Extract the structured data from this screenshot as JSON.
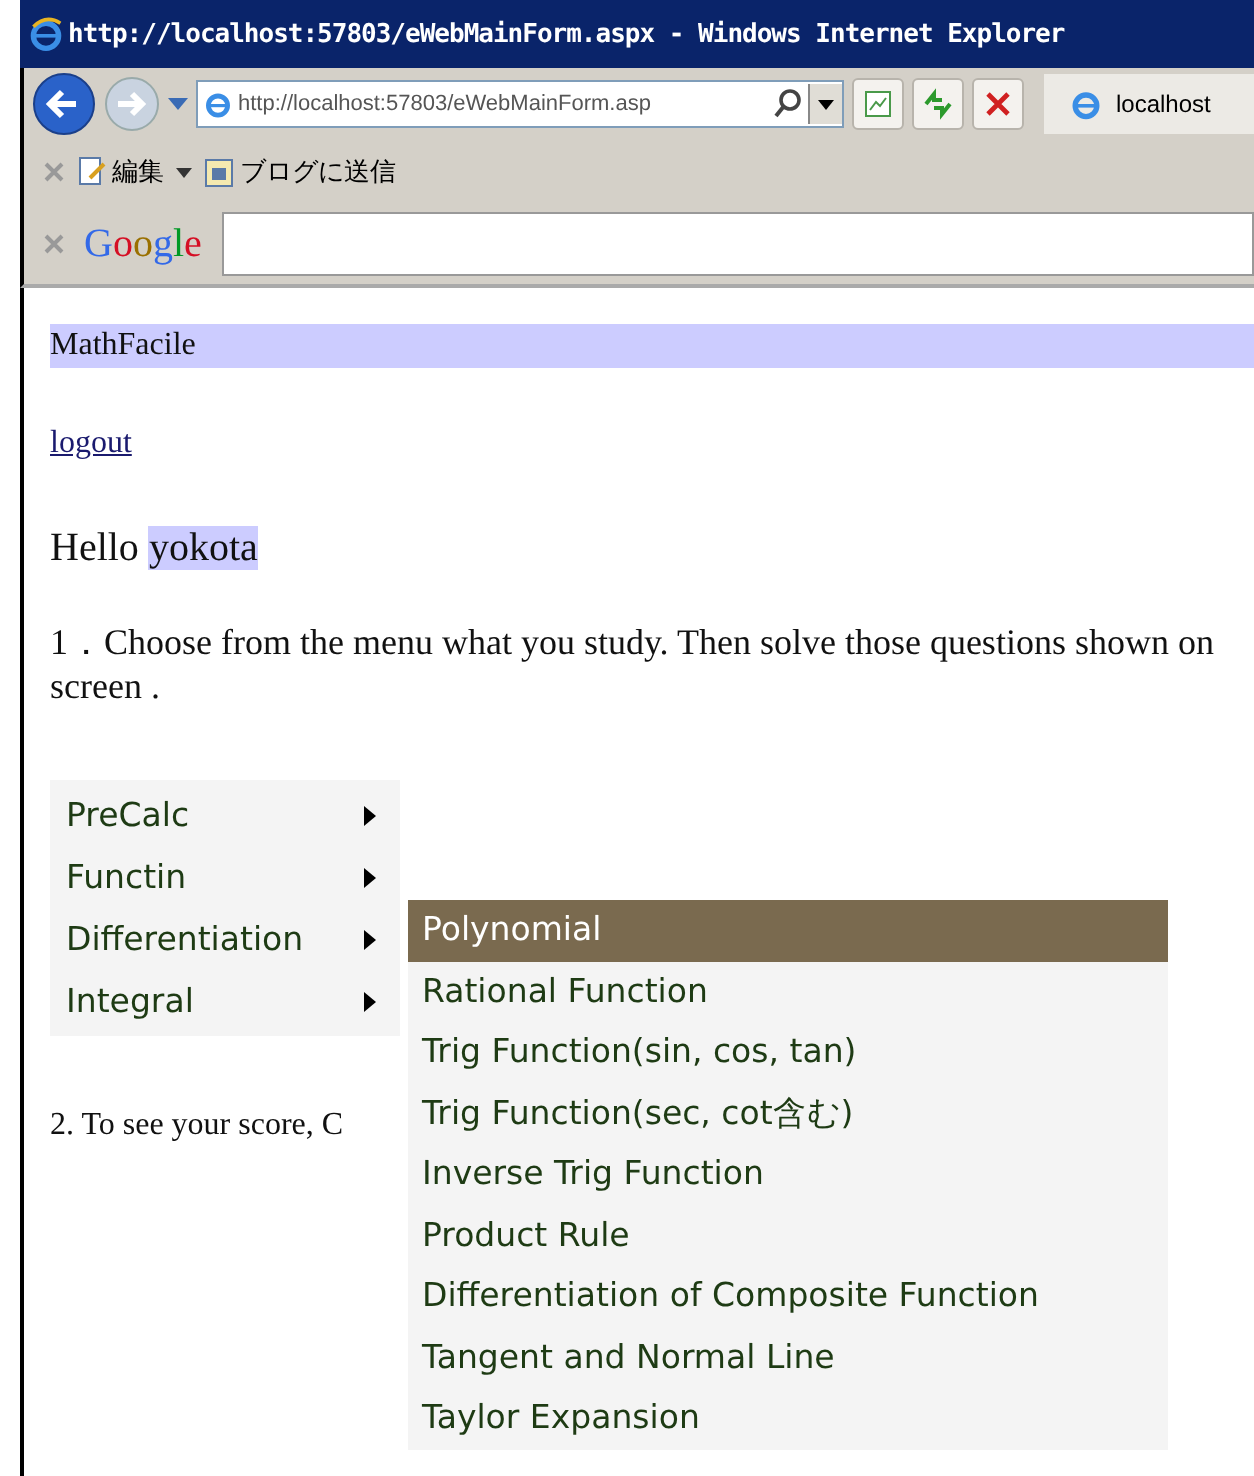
{
  "window": {
    "title": "http://localhost:57803/eWebMainForm.aspx - Windows Internet Explorer"
  },
  "navbar": {
    "address": "http://localhost:57803/eWebMainForm.asp",
    "tab": "localhost"
  },
  "toolbar": {
    "items": [
      "編集",
      "ブログに送信"
    ]
  },
  "google_bar": {
    "logo": "Google"
  },
  "page": {
    "site_title": "MathFacile",
    "logout": "logout",
    "greeting": "Hello",
    "user": "yokota",
    "instruction": "1．Choose from the menu what you study. Then solve those questions shown on screen .",
    "score_note": "2. To see your score, C",
    "menu": [
      {
        "label": "PreCalc"
      },
      {
        "label": "Functin"
      },
      {
        "label": "Differentiation"
      },
      {
        "label": "Integral"
      }
    ],
    "submenu": [
      {
        "label": "Polynomial",
        "selected": true
      },
      {
        "label": "Rational Function",
        "selected": false
      },
      {
        "label": "Trig Function(sin, cos, tan)",
        "selected": false
      },
      {
        "label": "Trig Function(sec, cot含む)",
        "selected": false
      },
      {
        "label": "Inverse Trig Function",
        "selected": false
      },
      {
        "label": "Product Rule",
        "selected": false
      },
      {
        "label": "Differentiation of Composite Function",
        "selected": false
      },
      {
        "label": "Tangent and Normal Line",
        "selected": false
      },
      {
        "label": "Taylor Expansion",
        "selected": false
      }
    ]
  }
}
